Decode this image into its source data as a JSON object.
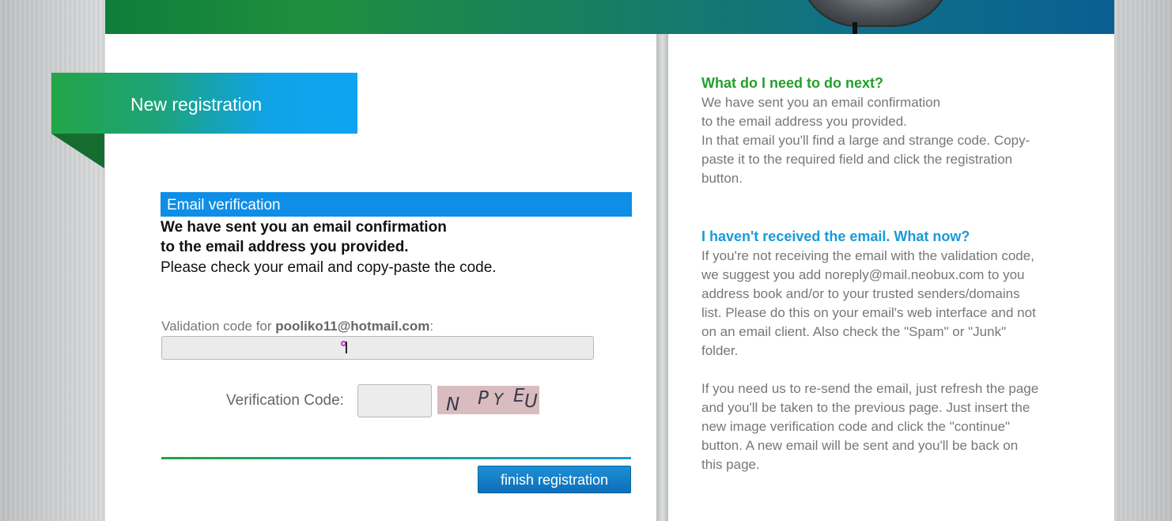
{
  "colors": {
    "ribbon_start": "#22a547",
    "ribbon_end": "#0ea4f3",
    "section_header": "#0e8ee6",
    "heading_green": "#23a02a",
    "heading_blue": "#1a9ad6",
    "button": "#1480c9"
  },
  "registration": {
    "title": "New registration",
    "section_header": "Email verification",
    "bold_lines": [
      "We have sent you an email confirmation",
      "to the email address you provided."
    ],
    "instruction": "Please check your email and copy-paste the code.",
    "validation_label_prefix": "Validation code for ",
    "validation_email": "pooliko11@hotmail.com",
    "validation_label_suffix": ":",
    "validation_value": "",
    "verification_label": "Verification Code:",
    "verification_value": "",
    "captcha_chars": [
      "N",
      "P",
      "Y",
      "E",
      "U"
    ],
    "finish_button": "finish registration"
  },
  "help": {
    "next_heading": "What do I need to do next?",
    "next_lines": [
      "We have sent you an email confirmation",
      "to the email address you provided.",
      "In that email you'll find a large and strange code. Copy-",
      "paste it to the required field and click the registration",
      "button."
    ],
    "not_received_heading": "I haven't received the email. What now?",
    "not_received_lines": [
      "If you're not receiving the email with the validation code,",
      "we suggest you add noreply@mail.neobux.com to you",
      "address book and/or to your trusted senders/domains",
      "list. Please do this on your email's web interface and not",
      "on an email client. Also check the \"Spam\" or \"Junk\"",
      "folder."
    ],
    "resend_lines": [
      "If you need us to re-send the email, just refresh the page",
      "and you'll be taken to the previous page. Just insert the",
      "new image verification code and click the \"continue\"",
      "button. A new email will be sent and you'll be back on",
      "this page."
    ]
  }
}
